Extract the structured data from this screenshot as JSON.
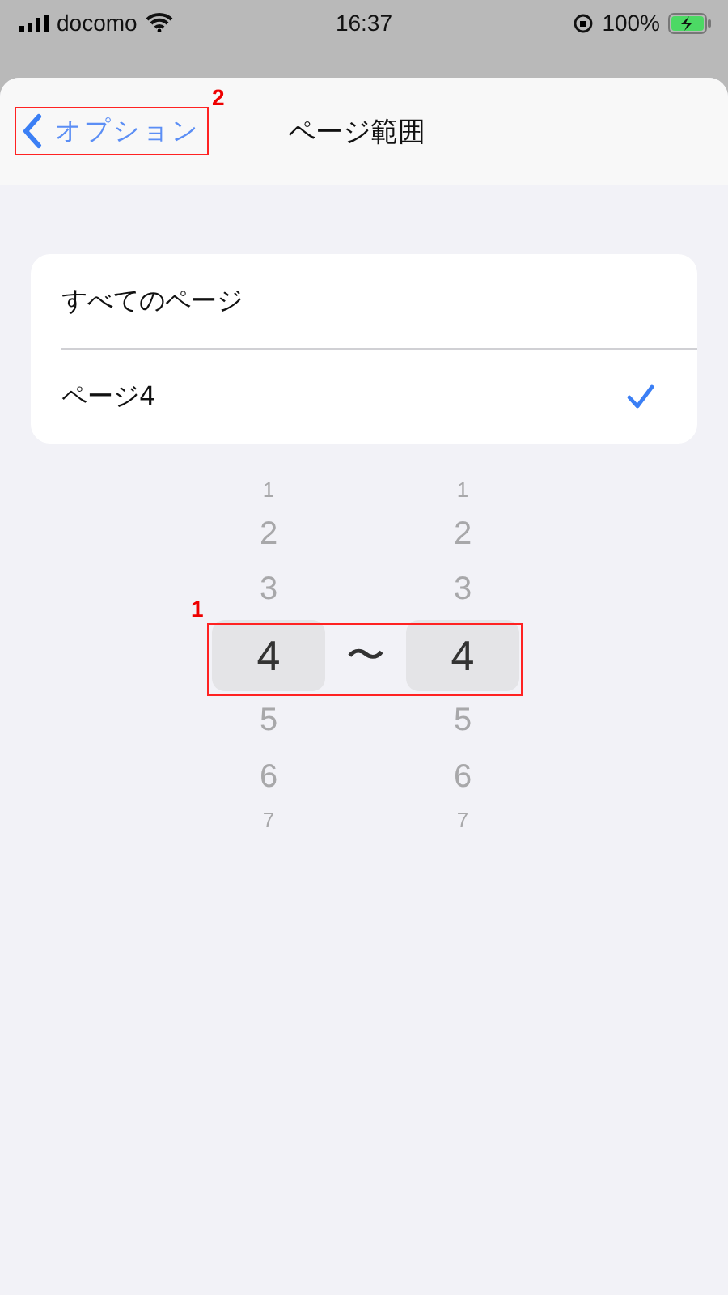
{
  "status_bar": {
    "carrier": "docomo",
    "time": "16:37",
    "battery": "100%"
  },
  "nav": {
    "back": "オプション",
    "title": "ページ範囲"
  },
  "options": [
    {
      "label": "すべてのページ",
      "selected": false
    },
    {
      "label": "ページ4",
      "selected": true
    }
  ],
  "picker": {
    "separator": "〜",
    "columns": [
      {
        "items": [
          {
            "label": "1",
            "selected": false
          },
          {
            "label": "2",
            "selected": false
          },
          {
            "label": "3",
            "selected": false
          },
          {
            "label": "4",
            "selected": true
          },
          {
            "label": "5",
            "selected": false
          },
          {
            "label": "6",
            "selected": false
          },
          {
            "label": "7",
            "selected": false
          }
        ]
      },
      {
        "items": [
          {
            "label": "1",
            "selected": false
          },
          {
            "label": "2",
            "selected": false
          },
          {
            "label": "3",
            "selected": false
          },
          {
            "label": "4",
            "selected": true
          },
          {
            "label": "5",
            "selected": false
          },
          {
            "label": "6",
            "selected": false
          },
          {
            "label": "7",
            "selected": false
          }
        ]
      }
    ]
  },
  "annotations": [
    {
      "label": "1"
    },
    {
      "label": "2"
    }
  ]
}
